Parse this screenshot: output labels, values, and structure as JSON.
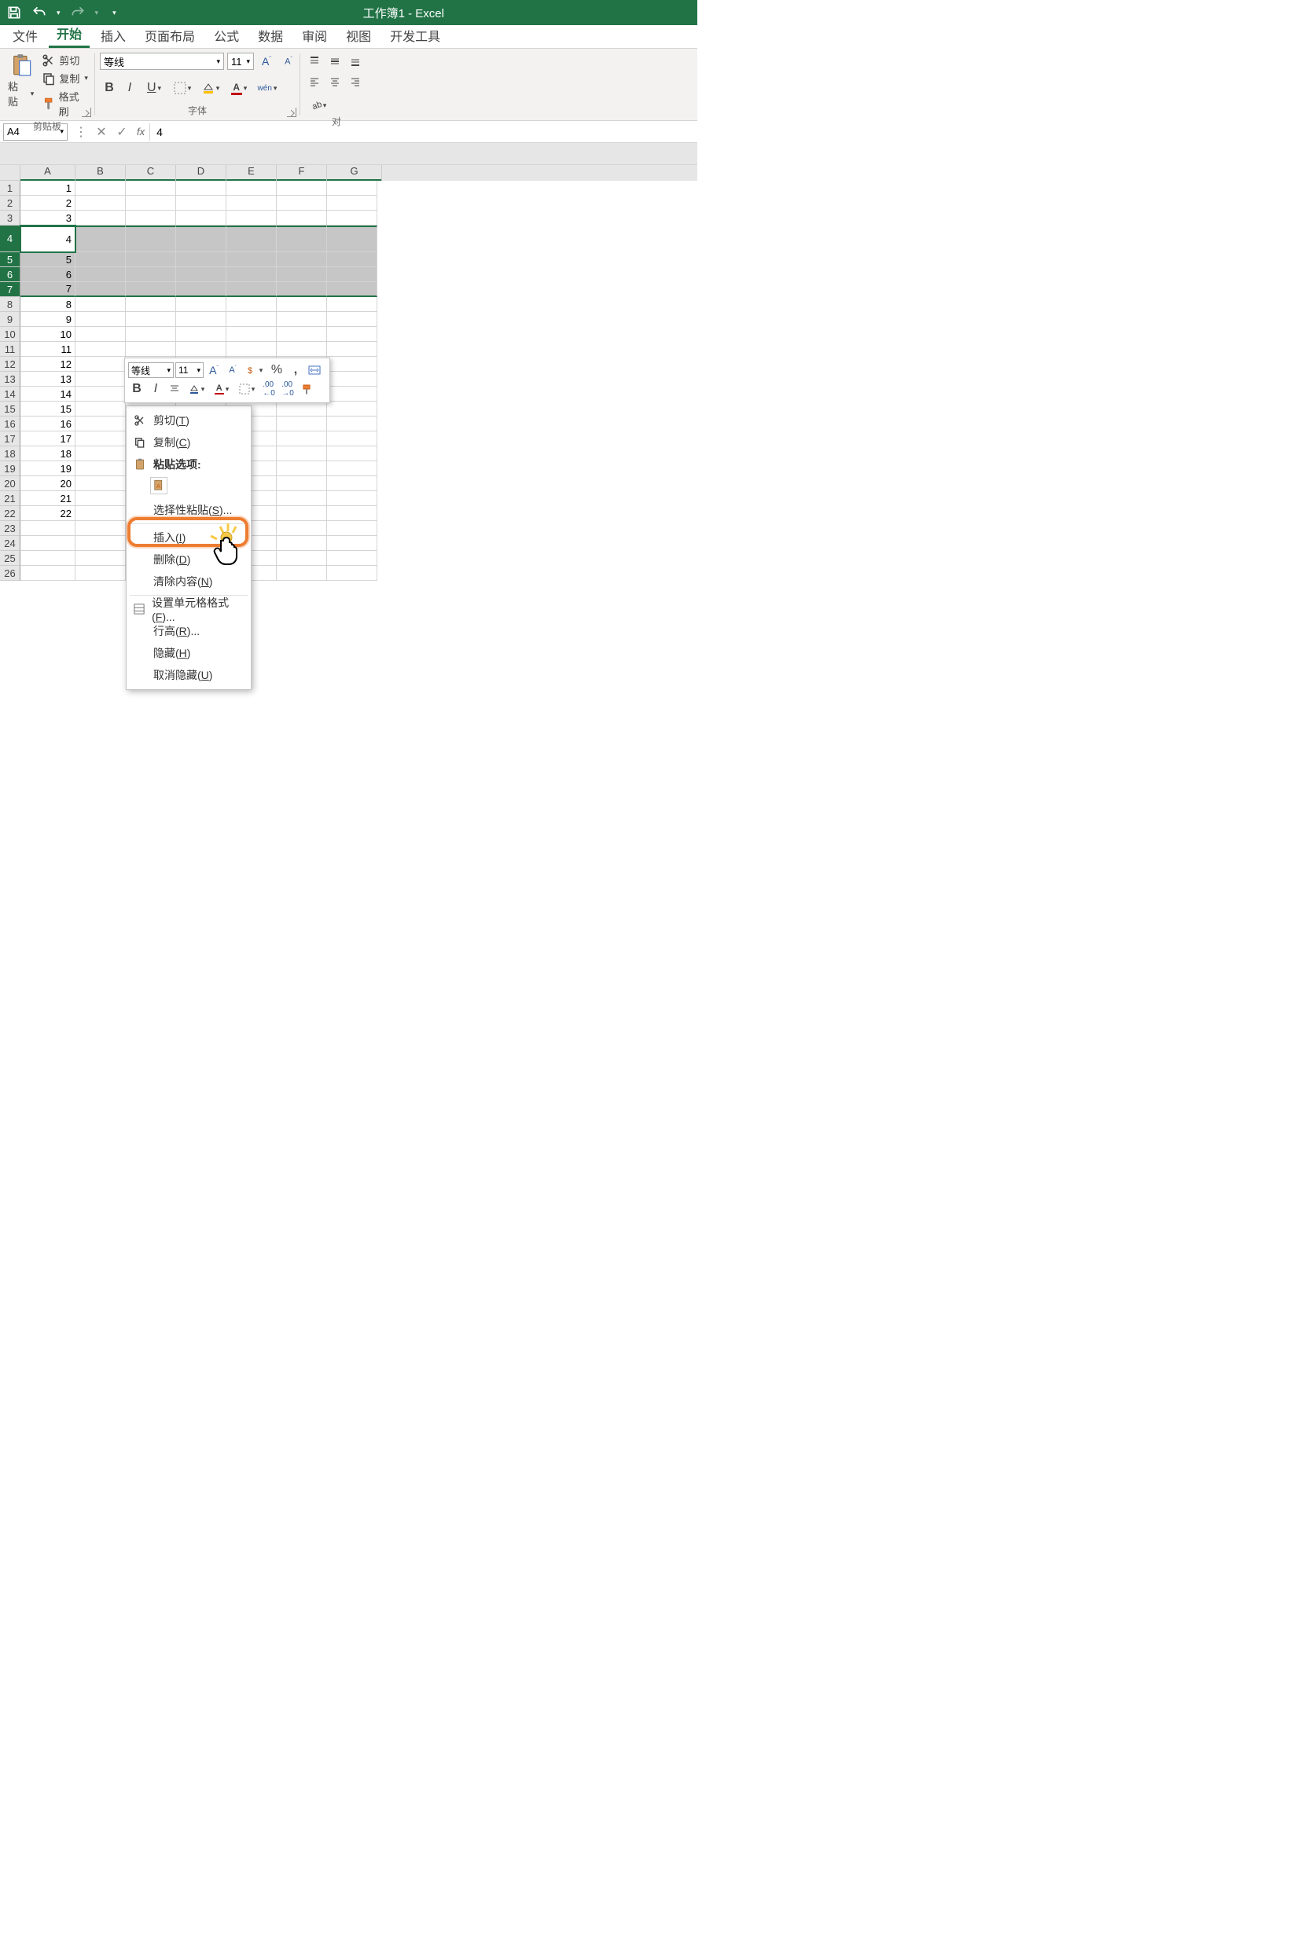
{
  "title": "工作簿1 - Excel",
  "tabs": [
    "文件",
    "开始",
    "插入",
    "页面布局",
    "公式",
    "数据",
    "审阅",
    "视图",
    "开发工具"
  ],
  "active_tab_index": 1,
  "clipboard": {
    "paste": "粘贴",
    "cut": "剪切",
    "copy": "复制",
    "format_painter": "格式刷",
    "group_label": "剪贴板"
  },
  "font": {
    "name": "等线",
    "size": "11",
    "group_label": "字体",
    "phonetic": "wén"
  },
  "align": {
    "group_label": "对"
  },
  "name_box": "A4",
  "formula_value": "4",
  "columns": [
    "A",
    "B",
    "C",
    "D",
    "E",
    "F",
    "G"
  ],
  "rows": [
    {
      "n": 1,
      "v": "1"
    },
    {
      "n": 2,
      "v": "2"
    },
    {
      "n": 3,
      "v": "3"
    },
    {
      "n": 4,
      "v": "4"
    },
    {
      "n": 5,
      "v": "5"
    },
    {
      "n": 6,
      "v": "6"
    },
    {
      "n": 7,
      "v": "7"
    },
    {
      "n": 8,
      "v": "8"
    },
    {
      "n": 9,
      "v": "9"
    },
    {
      "n": 10,
      "v": "10"
    },
    {
      "n": 11,
      "v": "11"
    },
    {
      "n": 12,
      "v": "12"
    },
    {
      "n": 13,
      "v": "13"
    },
    {
      "n": 14,
      "v": "14"
    },
    {
      "n": 15,
      "v": "15"
    },
    {
      "n": 16,
      "v": "16"
    },
    {
      "n": 17,
      "v": "17"
    },
    {
      "n": 18,
      "v": "18"
    },
    {
      "n": 19,
      "v": "19"
    },
    {
      "n": 20,
      "v": "20"
    },
    {
      "n": 21,
      "v": "21"
    },
    {
      "n": 22,
      "v": "22"
    },
    {
      "n": 23,
      "v": ""
    },
    {
      "n": 24,
      "v": ""
    },
    {
      "n": 25,
      "v": ""
    },
    {
      "n": 26,
      "v": ""
    }
  ],
  "selected_rows": [
    4,
    5,
    6,
    7
  ],
  "active_cell_row": 4,
  "mini_toolbar": {
    "font": "等线",
    "size": "11"
  },
  "context_menu": {
    "cut": "剪切(T)",
    "copy": "复制(C)",
    "paste_options": "粘贴选项:",
    "paste_special": "选择性粘贴(S)...",
    "insert": "插入(I)",
    "delete": "删除(D)",
    "clear": "清除内容(N)",
    "format_cells": "设置单元格格式(F)...",
    "row_height": "行高(R)...",
    "hide": "隐藏(H)",
    "unhide": "取消隐藏(U)"
  }
}
